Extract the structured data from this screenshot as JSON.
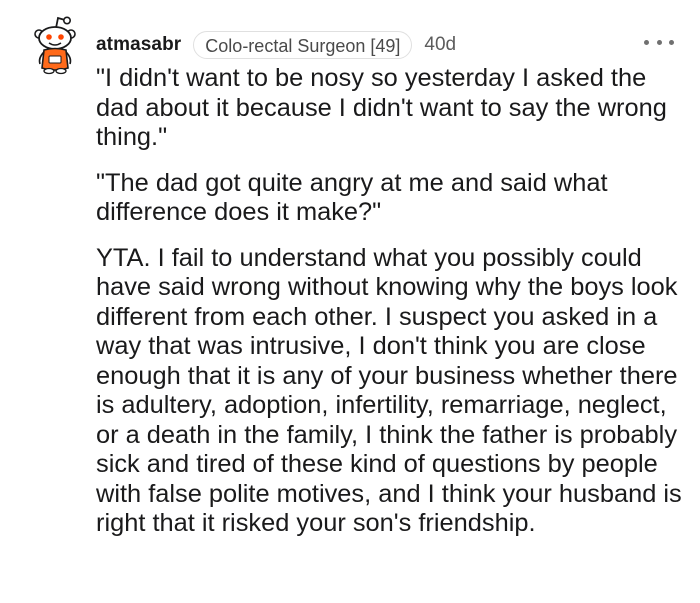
{
  "comment": {
    "username": "atmasabr",
    "flair": "Colo-rectal Surgeon [49]",
    "timestamp": "40d",
    "paragraphs": [
      "\"I didn't want to be nosy so yesterday I asked the dad about it because I didn't want to say the wrong thing.\"",
      "\"The dad got quite angry at me and said what difference does it make?\"",
      "YTA. I fail to understand what you possibly could have said wrong without knowing why the boys look different from each other. I suspect you asked in a way that was intrusive, I don't think you are close enough that it is any of your business whether there is adultery, adoption, infertility, remarriage, neglect, or a death in the family, I think the father is probably sick and tired of these kind of questions by people with false polite motives, and I think your husband is right that it risked your son's friendship."
    ]
  },
  "icons": {
    "avatar": "snoo-avatar-icon",
    "more": "more-options-icon"
  },
  "colors": {
    "text": "#1a1a1b",
    "meta": "#5c5c5c",
    "flair_border": "#e0e0e0",
    "avatar_accent": "#ff6a1a"
  }
}
